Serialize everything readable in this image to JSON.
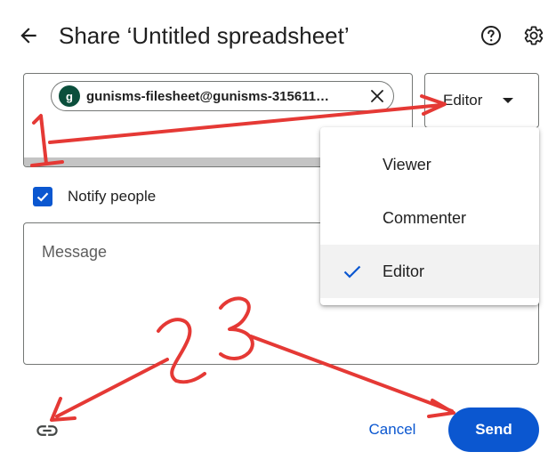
{
  "dialog": {
    "title": "Share ‘Untitled spreadsheet’",
    "back_icon": "arrow-left-icon",
    "help_icon": "help-circle-icon",
    "settings_icon": "gear-icon"
  },
  "recipients": {
    "chips": [
      {
        "avatar_initial": "g",
        "email": "gunisms-filesheet@gunisms-315611…",
        "remove_icon": "close-icon"
      }
    ]
  },
  "role_select": {
    "selected": "Editor",
    "caret_icon": "caret-down-icon",
    "options": [
      {
        "label": "Viewer",
        "checked": false
      },
      {
        "label": "Commenter",
        "checked": false
      },
      {
        "label": "Editor",
        "checked": true
      }
    ]
  },
  "notify": {
    "label": "Notify people",
    "checked": true
  },
  "message": {
    "placeholder": "Message",
    "value": ""
  },
  "footer": {
    "copy_link_icon": "link-icon",
    "cancel_label": "Cancel",
    "send_label": "Send"
  },
  "annotations": {
    "color": "#e53935",
    "marks": [
      {
        "label": "1",
        "points_to": "role-select"
      },
      {
        "label": "2",
        "points_to": "copy-link-button"
      },
      {
        "label": "3",
        "points_to": "send-button"
      }
    ]
  },
  "colors": {
    "primary": "#0b57d0",
    "avatar": "#0b4f3c",
    "annotation": "#e53935"
  }
}
